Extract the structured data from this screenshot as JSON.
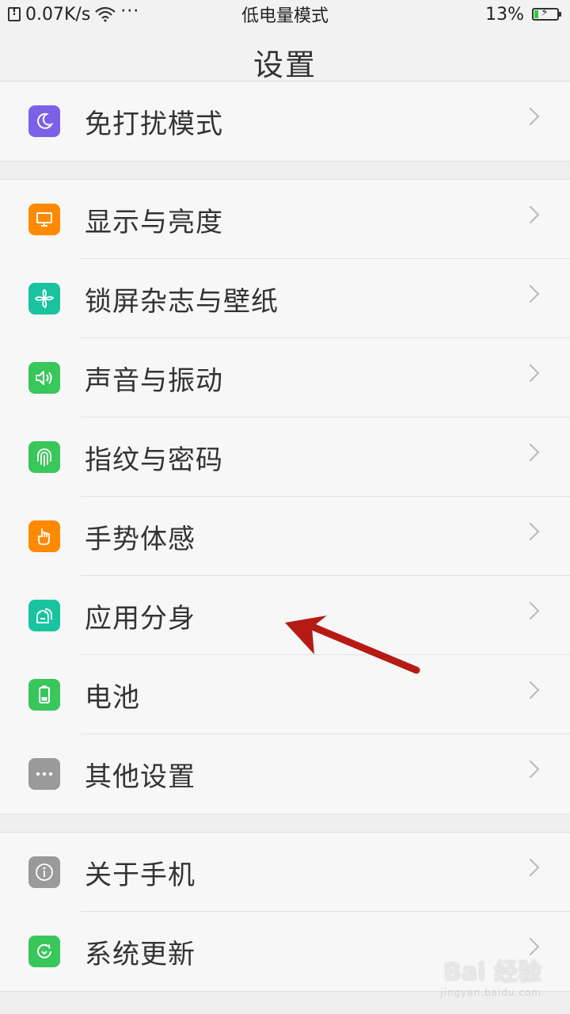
{
  "status_bar": {
    "speed": "0.07K/s",
    "more": "···",
    "mode": "低电量模式",
    "battery_percent": "13%",
    "battery_level": 0.13
  },
  "header": {
    "title": "设置"
  },
  "groups": [
    {
      "items": [
        {
          "label": "免打扰模式",
          "icon": "moon-icon",
          "color": "#7b61e8"
        }
      ]
    },
    {
      "items": [
        {
          "label": "显示与亮度",
          "icon": "monitor-icon",
          "color": "#ff8a00"
        },
        {
          "label": "锁屏杂志与壁纸",
          "icon": "pinwheel-icon",
          "color": "#19c3a0"
        },
        {
          "label": "声音与振动",
          "icon": "speaker-icon",
          "color": "#39c65b"
        },
        {
          "label": "指纹与密码",
          "icon": "fingerprint-icon",
          "color": "#39c65b"
        },
        {
          "label": "手势体感",
          "icon": "hand-pointer-icon",
          "color": "#ff8a00"
        },
        {
          "label": "应用分身",
          "icon": "android-clone-icon",
          "color": "#19c3a0"
        },
        {
          "label": "电池",
          "icon": "battery-icon",
          "color": "#39c65b"
        },
        {
          "label": "其他设置",
          "icon": "more-icon",
          "color": "#9a9a9a"
        }
      ]
    },
    {
      "items": [
        {
          "label": "关于手机",
          "icon": "info-icon",
          "color": "#9a9a9a"
        },
        {
          "label": "系统更新",
          "icon": "update-icon",
          "color": "#39c65b"
        }
      ]
    }
  ],
  "watermark": {
    "logo": "Bai 经验",
    "url": "jingyan.baidu.com"
  },
  "annotation": {
    "color": "#b51b14"
  }
}
